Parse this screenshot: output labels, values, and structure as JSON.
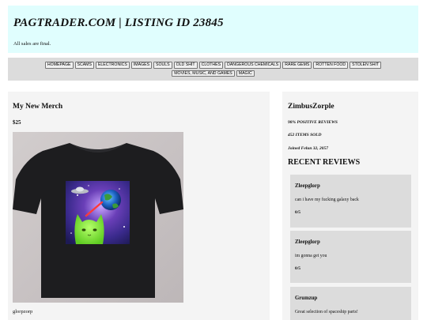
{
  "header": {
    "site_title": "PAGTRADER.COM | LISTING ID 23845",
    "tagline": "All sales are final."
  },
  "nav": {
    "items": [
      "HOMEPAGE",
      "SCAMS",
      "ELECTRONICS",
      "IMAGES",
      "SOULS",
      "OLD SHIT",
      "CLOTHES",
      "DANGEROUS CHEMICALS",
      "RARE GEMS",
      "ROTTEN FOOD",
      "STOLEN SHIT",
      "MOVIES, MUSIC, AND GAMES",
      "MAGIC"
    ]
  },
  "listing": {
    "title": "My New Merch",
    "price": "$25",
    "image_icon": "tshirt-cat-space-graphic",
    "description": "glorpzorp"
  },
  "seller": {
    "name": "ZimbusZorple",
    "positive_reviews": "98% POSITIVE REVIEWS",
    "items_sold": "452 ITEMS SOLD",
    "joined": "Joined Felun 32, 2057"
  },
  "reviews": {
    "heading": "RECENT REVIEWS",
    "items": [
      {
        "author": "Zleepglorp",
        "text": "can i have my fucking galaxy back",
        "rating": "0/5"
      },
      {
        "author": "Zleepglorp",
        "text": "im gonna get you",
        "rating": "0/5"
      },
      {
        "author": "Grumzup",
        "text": "Great selection of spaceship parts!",
        "rating": ""
      }
    ]
  },
  "colors": {
    "header_bg": "#e0fefe",
    "nav_bg": "#dcdcdc",
    "panel_bg": "#f4f4f4",
    "review_bg": "#dcdcdc"
  }
}
